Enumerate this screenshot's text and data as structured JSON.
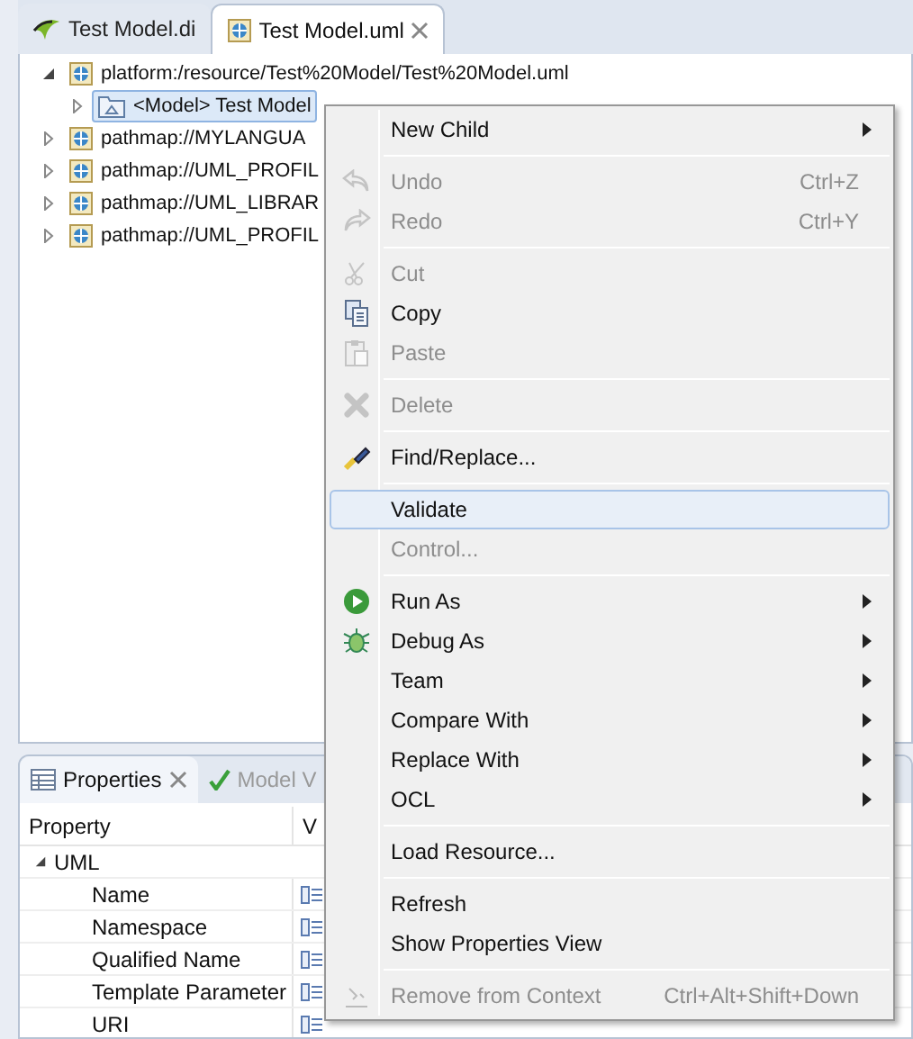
{
  "editor_tabs": [
    {
      "label": "Test Model.di",
      "selected": false
    },
    {
      "label": "Test Model.uml",
      "selected": true
    }
  ],
  "tree": [
    {
      "label": "platform:/resource/Test%20Model/Test%20Model.uml",
      "expanded": true,
      "selected": false,
      "children": [
        {
          "label": "<Model> Test Model",
          "expanded": false,
          "selected": true
        }
      ]
    },
    {
      "label": "pathmap://MYLANGUA",
      "expanded": false,
      "selected": false
    },
    {
      "label": "pathmap://UML_PROFIL",
      "expanded": false,
      "selected": false
    },
    {
      "label": "pathmap://UML_LIBRAR",
      "expanded": false,
      "selected": false
    },
    {
      "label": "pathmap://UML_PROFIL",
      "expanded": false,
      "selected": false
    }
  ],
  "bottom_tabs": [
    {
      "label": "Properties",
      "selected": true
    },
    {
      "label": "Model V",
      "selected": false
    }
  ],
  "properties": {
    "columns": [
      "Property",
      "V"
    ],
    "groups": [
      {
        "label": "UML",
        "expanded": true,
        "rows": [
          "Name",
          "Namespace",
          "Qualified Name",
          "Template Parameter",
          "URI"
        ]
      }
    ]
  },
  "context_menu": {
    "sections": [
      [
        {
          "label": "New Child",
          "disabled": false,
          "submenu": true,
          "selected": false
        }
      ],
      [
        {
          "label": "Undo",
          "shortcut": "Ctrl+Z",
          "disabled": true,
          "submenu": false,
          "selected": false
        },
        {
          "label": "Redo",
          "shortcut": "Ctrl+Y",
          "disabled": true,
          "submenu": false,
          "selected": false
        }
      ],
      [
        {
          "label": "Cut",
          "disabled": true,
          "submenu": false,
          "selected": false
        },
        {
          "label": "Copy",
          "disabled": false,
          "submenu": false,
          "selected": false
        },
        {
          "label": "Paste",
          "disabled": true,
          "submenu": false,
          "selected": false
        }
      ],
      [
        {
          "label": "Delete",
          "disabled": true,
          "submenu": false,
          "selected": false
        }
      ],
      [
        {
          "label": "Find/Replace...",
          "disabled": false,
          "submenu": false,
          "selected": false
        }
      ],
      [
        {
          "label": "Validate",
          "disabled": false,
          "submenu": false,
          "selected": true
        },
        {
          "label": "Control...",
          "disabled": true,
          "submenu": false,
          "selected": false
        }
      ],
      [
        {
          "label": "Run As",
          "disabled": false,
          "submenu": true,
          "selected": false
        },
        {
          "label": "Debug As",
          "disabled": false,
          "submenu": true,
          "selected": false
        },
        {
          "label": "Team",
          "disabled": false,
          "submenu": true,
          "selected": false
        },
        {
          "label": "Compare With",
          "disabled": false,
          "submenu": true,
          "selected": false
        },
        {
          "label": "Replace With",
          "disabled": false,
          "submenu": true,
          "selected": false
        },
        {
          "label": "OCL",
          "disabled": false,
          "submenu": true,
          "selected": false
        }
      ],
      [
        {
          "label": "Load Resource...",
          "disabled": false,
          "submenu": false,
          "selected": false
        }
      ],
      [
        {
          "label": "Refresh",
          "disabled": false,
          "submenu": false,
          "selected": false
        },
        {
          "label": "Show Properties View",
          "disabled": false,
          "submenu": false,
          "selected": false
        }
      ],
      [
        {
          "label": "Remove from Context",
          "shortcut": "Ctrl+Alt+Shift+Down",
          "disabled": true,
          "submenu": false,
          "selected": false
        }
      ]
    ]
  }
}
